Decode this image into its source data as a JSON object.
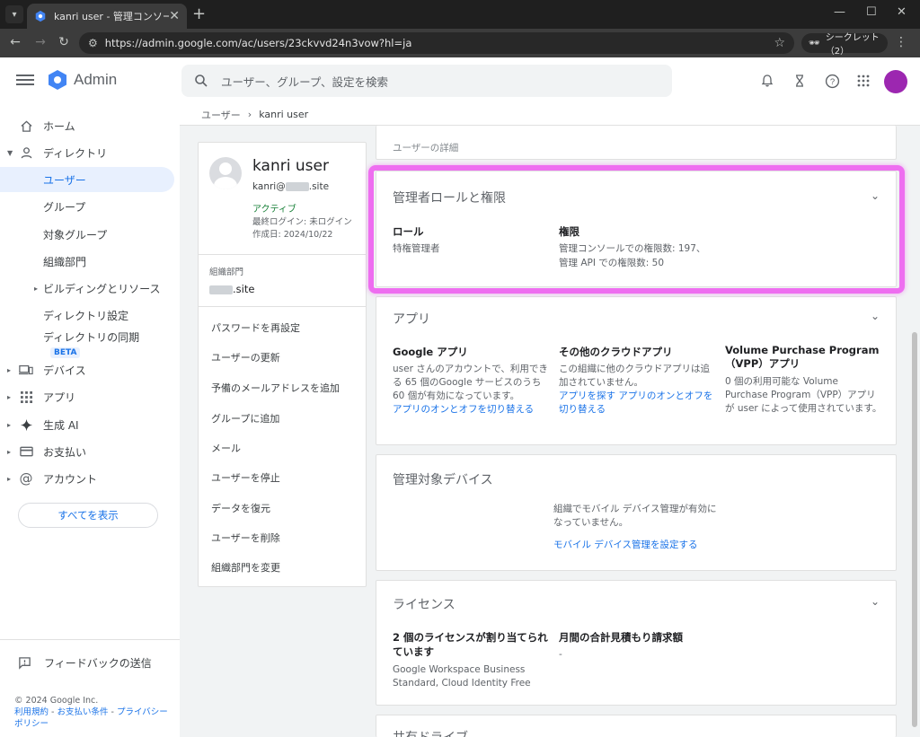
{
  "browser": {
    "tab_title": "kanri user - 管理コンソール",
    "url": "https://admin.google.com/ac/users/23ckvvd24n3vow?hl=ja",
    "incognito_label": "シークレット（2）"
  },
  "header": {
    "product": "Admin",
    "search_placeholder": "ユーザー、グループ、設定を検索"
  },
  "sidebar": {
    "items": [
      {
        "label": "ホーム",
        "icon": "home-icon"
      },
      {
        "label": "ディレクトリ",
        "icon": "person-icon"
      },
      {
        "label": "ユーザー",
        "active": true
      },
      {
        "label": "グループ"
      },
      {
        "label": "対象グループ"
      },
      {
        "label": "組織部門"
      },
      {
        "label": "ビルディングとリソース"
      },
      {
        "label": "ディレクトリ設定"
      },
      {
        "label": "ディレクトリの同期",
        "badge": "BETA"
      },
      {
        "label": "デバイス",
        "icon": "devices-icon"
      },
      {
        "label": "アプリ",
        "icon": "apps-grid-icon"
      },
      {
        "label": "生成 AI",
        "icon": "sparkle-icon"
      },
      {
        "label": "お支払い",
        "icon": "credit-card-icon"
      },
      {
        "label": "アカウント",
        "icon": "at-sign-icon"
      }
    ],
    "show_all": "すべてを表示",
    "feedback": "フィードバックの送信",
    "footer": {
      "copyright": "© 2024 Google Inc.",
      "terms": "利用規約",
      "sep1": " - ",
      "billing_terms": "お支払い条件",
      "sep2": " - ",
      "privacy": "プライバシー",
      "policy": "ポリシー"
    }
  },
  "breadcrumb": {
    "parent": "ユーザー",
    "separator": "›",
    "current": "kanri user"
  },
  "user_card": {
    "name": "kanri user",
    "email_prefix": "kanri@",
    "email_suffix": ".site",
    "status": "アクティブ",
    "last_login": "最終ログイン: 未ログイン",
    "created": "作成日: 2024/10/22",
    "org_label": "組織部門",
    "org_value": ".site",
    "actions": [
      "パスワードを再設定",
      "ユーザーの更新",
      "予備のメールアドレスを追加",
      "グループに追加",
      "メール",
      "ユーザーを停止",
      "データを復元",
      "ユーザーを削除",
      "組織部門を変更"
    ]
  },
  "details_panel": {
    "partial_top_text": "ユーザーの詳細"
  },
  "admin_roles": {
    "title": "管理者ロールと権限",
    "role_header": "ロール",
    "role_value": "特権管理者",
    "privileges_header": "権限",
    "privileges_line1": "管理コンソールでの権限数: 197、",
    "privileges_line2": "管理 API での権限数: 50"
  },
  "apps": {
    "title": "アプリ",
    "google_apps_title": "Google アプリ",
    "google_apps_text": "user さんのアカウントで、利用できる 65 個のGoogle サービスのうち 60 個が有効になっています。",
    "google_apps_link": "アプリのオンとオフを切り替える",
    "cloud_apps_title": "その他のクラウドアプリ",
    "cloud_apps_text": "この組織に他のクラウドアプリは追加されていません。",
    "cloud_apps_link": "アプリを探す アプリのオンとオフを切り替える",
    "vpp_title": "Volume Purchase Program（VPP）アプリ",
    "vpp_text": "0 個の利用可能な Volume Purchase Program（VPP）アプリが user によって使用されています。"
  },
  "devices": {
    "title": "管理対象デバイス",
    "text": "組織でモバイル デバイス管理が有効になっていません。",
    "link": "モバイル デバイス管理を設定する"
  },
  "licenses": {
    "title": "ライセンス",
    "assigned_title": "2 個のライセンスが割り当てられています",
    "assigned_text": "Google Workspace Business Standard, Cloud Identity Free",
    "monthly_title": "月間の合計見積もり請求額",
    "monthly_value": "-"
  },
  "partial_bottom_title": "共有ドライブ",
  "colors": {
    "accent": "#1a73e8",
    "highlight": "#ee6ef0",
    "active_green": "#188038"
  }
}
